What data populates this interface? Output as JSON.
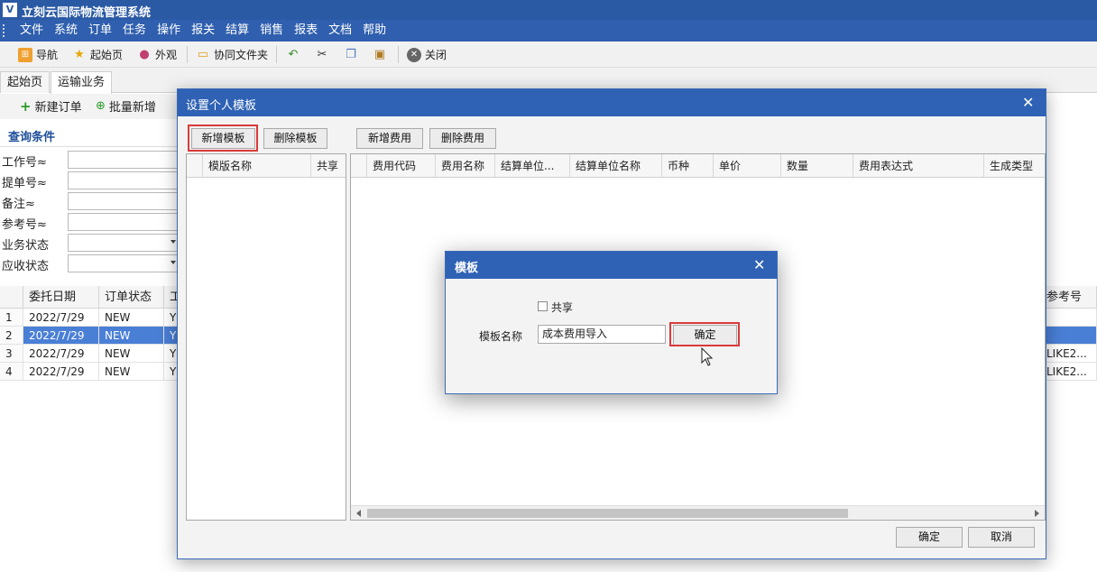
{
  "app": {
    "title": "立刻云国际物流管理系统",
    "logo_glyph": "V"
  },
  "menu": [
    "文件",
    "系统",
    "订单",
    "任务",
    "操作",
    "报关",
    "结算",
    "销售",
    "报表",
    "文档",
    "帮助"
  ],
  "toolbar": {
    "nav": "导航",
    "home": "起始页",
    "appearance": "外观",
    "shared_folder": "协同文件夹",
    "close": "关闭"
  },
  "tabs": [
    "起始页",
    "运输业务"
  ],
  "subtoolbar": {
    "new_order": "新建订单",
    "batch_add": "批量新增"
  },
  "query": {
    "title": "查询条件",
    "fields": [
      "工作号≈",
      "提单号≈",
      "备注≈",
      "参考号≈",
      "业务状态",
      "应收状态"
    ]
  },
  "grid": {
    "headers": [
      "委托日期",
      "订单状态",
      "工",
      "参考号"
    ],
    "rows": [
      {
        "n": "1",
        "date": "2022/7/29",
        "status": "NEW",
        "work": "YS",
        "ref": ""
      },
      {
        "n": "2",
        "date": "2022/7/29",
        "status": "NEW",
        "work": "YS",
        "ref": ""
      },
      {
        "n": "3",
        "date": "2022/7/29",
        "status": "NEW",
        "work": "YS",
        "ref": "LIKE2..."
      },
      {
        "n": "4",
        "date": "2022/7/29",
        "status": "NEW",
        "work": "YS",
        "ref": "LIKE2..."
      }
    ],
    "selected_row": 2
  },
  "dialog_template": {
    "title": "设置个人模板",
    "buttons": {
      "add_template": "新增模板",
      "delete_template": "删除模板",
      "add_fee": "新增费用",
      "delete_fee": "删除费用",
      "ok": "确定",
      "cancel": "取消"
    },
    "left_headers": [
      "模版名称",
      "共享"
    ],
    "right_headers": [
      "费用代码",
      "费用名称",
      "结算单位...",
      "结算单位名称",
      "币种",
      "单价",
      "数量",
      "费用表达式",
      "生成类型"
    ]
  },
  "dialog_name": {
    "title": "模板",
    "share_label": "共享",
    "share_checked": false,
    "name_label": "模板名称",
    "name_value": "成本费用导入",
    "ok": "确定"
  },
  "colors": {
    "titlebar": "#2b5aa5",
    "dialog_title": "#2f62b4",
    "selection": "#4a7fd6",
    "highlight_box": "#d93a3a"
  }
}
